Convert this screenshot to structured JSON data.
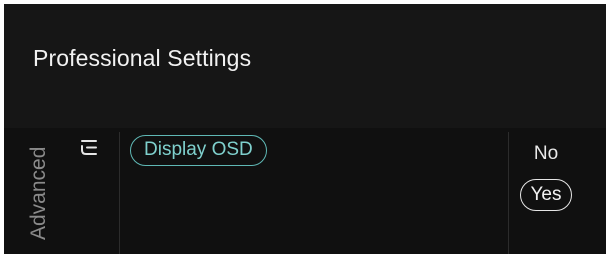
{
  "header": {
    "title": "Professional Settings"
  },
  "sidebar": {
    "category_label": "Advanced",
    "icon": "menu-lines-icon"
  },
  "menu": {
    "items": [
      {
        "label": "Display OSD",
        "selected": true
      }
    ]
  },
  "options": {
    "items": [
      {
        "label": "No",
        "selected": false
      },
      {
        "label": "Yes",
        "selected": true
      }
    ]
  },
  "colors": {
    "background": "#161616",
    "accent": "#5fb8b5",
    "text": "#f2f2f2",
    "muted": "#8a8a8a"
  }
}
